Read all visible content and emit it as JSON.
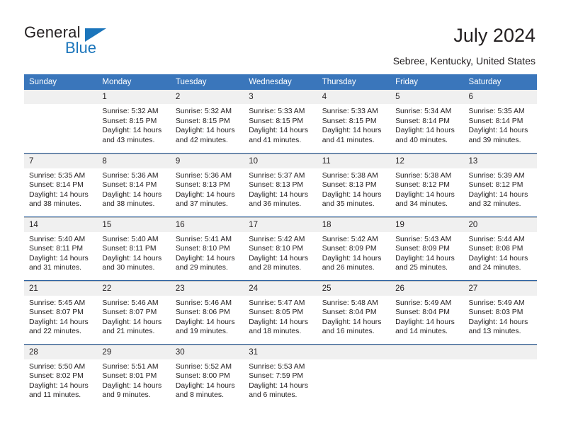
{
  "brand": {
    "name_part1": "General",
    "name_part2": "Blue",
    "color_primary": "#1b75bb",
    "color_text": "#231f20"
  },
  "header": {
    "title": "July 2024",
    "subtitle": "Sebree, Kentucky, United States",
    "accent_color": "#3a76bb",
    "band_color": "#f0f0f0"
  },
  "calendar": {
    "weekday_headers": [
      "Sunday",
      "Monday",
      "Tuesday",
      "Wednesday",
      "Thursday",
      "Friday",
      "Saturday"
    ],
    "labels": {
      "sunrise_prefix": "Sunrise:",
      "sunset_prefix": "Sunset:",
      "daylight_prefix": "Daylight:"
    },
    "weeks": [
      [
        {
          "day": "",
          "sunrise": "",
          "sunset": "",
          "daylight_line1": "",
          "daylight_line2": "",
          "empty": true
        },
        {
          "day": "1",
          "sunrise": "Sunrise: 5:32 AM",
          "sunset": "Sunset: 8:15 PM",
          "daylight_line1": "Daylight: 14 hours",
          "daylight_line2": "and 43 minutes.",
          "empty": false
        },
        {
          "day": "2",
          "sunrise": "Sunrise: 5:32 AM",
          "sunset": "Sunset: 8:15 PM",
          "daylight_line1": "Daylight: 14 hours",
          "daylight_line2": "and 42 minutes.",
          "empty": false
        },
        {
          "day": "3",
          "sunrise": "Sunrise: 5:33 AM",
          "sunset": "Sunset: 8:15 PM",
          "daylight_line1": "Daylight: 14 hours",
          "daylight_line2": "and 41 minutes.",
          "empty": false
        },
        {
          "day": "4",
          "sunrise": "Sunrise: 5:33 AM",
          "sunset": "Sunset: 8:15 PM",
          "daylight_line1": "Daylight: 14 hours",
          "daylight_line2": "and 41 minutes.",
          "empty": false
        },
        {
          "day": "5",
          "sunrise": "Sunrise: 5:34 AM",
          "sunset": "Sunset: 8:14 PM",
          "daylight_line1": "Daylight: 14 hours",
          "daylight_line2": "and 40 minutes.",
          "empty": false
        },
        {
          "day": "6",
          "sunrise": "Sunrise: 5:35 AM",
          "sunset": "Sunset: 8:14 PM",
          "daylight_line1": "Daylight: 14 hours",
          "daylight_line2": "and 39 minutes.",
          "empty": false
        }
      ],
      [
        {
          "day": "7",
          "sunrise": "Sunrise: 5:35 AM",
          "sunset": "Sunset: 8:14 PM",
          "daylight_line1": "Daylight: 14 hours",
          "daylight_line2": "and 38 minutes.",
          "empty": false
        },
        {
          "day": "8",
          "sunrise": "Sunrise: 5:36 AM",
          "sunset": "Sunset: 8:14 PM",
          "daylight_line1": "Daylight: 14 hours",
          "daylight_line2": "and 38 minutes.",
          "empty": false
        },
        {
          "day": "9",
          "sunrise": "Sunrise: 5:36 AM",
          "sunset": "Sunset: 8:13 PM",
          "daylight_line1": "Daylight: 14 hours",
          "daylight_line2": "and 37 minutes.",
          "empty": false
        },
        {
          "day": "10",
          "sunrise": "Sunrise: 5:37 AM",
          "sunset": "Sunset: 8:13 PM",
          "daylight_line1": "Daylight: 14 hours",
          "daylight_line2": "and 36 minutes.",
          "empty": false
        },
        {
          "day": "11",
          "sunrise": "Sunrise: 5:38 AM",
          "sunset": "Sunset: 8:13 PM",
          "daylight_line1": "Daylight: 14 hours",
          "daylight_line2": "and 35 minutes.",
          "empty": false
        },
        {
          "day": "12",
          "sunrise": "Sunrise: 5:38 AM",
          "sunset": "Sunset: 8:12 PM",
          "daylight_line1": "Daylight: 14 hours",
          "daylight_line2": "and 34 minutes.",
          "empty": false
        },
        {
          "day": "13",
          "sunrise": "Sunrise: 5:39 AM",
          "sunset": "Sunset: 8:12 PM",
          "daylight_line1": "Daylight: 14 hours",
          "daylight_line2": "and 32 minutes.",
          "empty": false
        }
      ],
      [
        {
          "day": "14",
          "sunrise": "Sunrise: 5:40 AM",
          "sunset": "Sunset: 8:11 PM",
          "daylight_line1": "Daylight: 14 hours",
          "daylight_line2": "and 31 minutes.",
          "empty": false
        },
        {
          "day": "15",
          "sunrise": "Sunrise: 5:40 AM",
          "sunset": "Sunset: 8:11 PM",
          "daylight_line1": "Daylight: 14 hours",
          "daylight_line2": "and 30 minutes.",
          "empty": false
        },
        {
          "day": "16",
          "sunrise": "Sunrise: 5:41 AM",
          "sunset": "Sunset: 8:10 PM",
          "daylight_line1": "Daylight: 14 hours",
          "daylight_line2": "and 29 minutes.",
          "empty": false
        },
        {
          "day": "17",
          "sunrise": "Sunrise: 5:42 AM",
          "sunset": "Sunset: 8:10 PM",
          "daylight_line1": "Daylight: 14 hours",
          "daylight_line2": "and 28 minutes.",
          "empty": false
        },
        {
          "day": "18",
          "sunrise": "Sunrise: 5:42 AM",
          "sunset": "Sunset: 8:09 PM",
          "daylight_line1": "Daylight: 14 hours",
          "daylight_line2": "and 26 minutes.",
          "empty": false
        },
        {
          "day": "19",
          "sunrise": "Sunrise: 5:43 AM",
          "sunset": "Sunset: 8:09 PM",
          "daylight_line1": "Daylight: 14 hours",
          "daylight_line2": "and 25 minutes.",
          "empty": false
        },
        {
          "day": "20",
          "sunrise": "Sunrise: 5:44 AM",
          "sunset": "Sunset: 8:08 PM",
          "daylight_line1": "Daylight: 14 hours",
          "daylight_line2": "and 24 minutes.",
          "empty": false
        }
      ],
      [
        {
          "day": "21",
          "sunrise": "Sunrise: 5:45 AM",
          "sunset": "Sunset: 8:07 PM",
          "daylight_line1": "Daylight: 14 hours",
          "daylight_line2": "and 22 minutes.",
          "empty": false
        },
        {
          "day": "22",
          "sunrise": "Sunrise: 5:46 AM",
          "sunset": "Sunset: 8:07 PM",
          "daylight_line1": "Daylight: 14 hours",
          "daylight_line2": "and 21 minutes.",
          "empty": false
        },
        {
          "day": "23",
          "sunrise": "Sunrise: 5:46 AM",
          "sunset": "Sunset: 8:06 PM",
          "daylight_line1": "Daylight: 14 hours",
          "daylight_line2": "and 19 minutes.",
          "empty": false
        },
        {
          "day": "24",
          "sunrise": "Sunrise: 5:47 AM",
          "sunset": "Sunset: 8:05 PM",
          "daylight_line1": "Daylight: 14 hours",
          "daylight_line2": "and 18 minutes.",
          "empty": false
        },
        {
          "day": "25",
          "sunrise": "Sunrise: 5:48 AM",
          "sunset": "Sunset: 8:04 PM",
          "daylight_line1": "Daylight: 14 hours",
          "daylight_line2": "and 16 minutes.",
          "empty": false
        },
        {
          "day": "26",
          "sunrise": "Sunrise: 5:49 AM",
          "sunset": "Sunset: 8:04 PM",
          "daylight_line1": "Daylight: 14 hours",
          "daylight_line2": "and 14 minutes.",
          "empty": false
        },
        {
          "day": "27",
          "sunrise": "Sunrise: 5:49 AM",
          "sunset": "Sunset: 8:03 PM",
          "daylight_line1": "Daylight: 14 hours",
          "daylight_line2": "and 13 minutes.",
          "empty": false
        }
      ],
      [
        {
          "day": "28",
          "sunrise": "Sunrise: 5:50 AM",
          "sunset": "Sunset: 8:02 PM",
          "daylight_line1": "Daylight: 14 hours",
          "daylight_line2": "and 11 minutes.",
          "empty": false
        },
        {
          "day": "29",
          "sunrise": "Sunrise: 5:51 AM",
          "sunset": "Sunset: 8:01 PM",
          "daylight_line1": "Daylight: 14 hours",
          "daylight_line2": "and 9 minutes.",
          "empty": false
        },
        {
          "day": "30",
          "sunrise": "Sunrise: 5:52 AM",
          "sunset": "Sunset: 8:00 PM",
          "daylight_line1": "Daylight: 14 hours",
          "daylight_line2": "and 8 minutes.",
          "empty": false
        },
        {
          "day": "31",
          "sunrise": "Sunrise: 5:53 AM",
          "sunset": "Sunset: 7:59 PM",
          "daylight_line1": "Daylight: 14 hours",
          "daylight_line2": "and 6 minutes.",
          "empty": false
        },
        {
          "day": "",
          "sunrise": "",
          "sunset": "",
          "daylight_line1": "",
          "daylight_line2": "",
          "empty": true
        },
        {
          "day": "",
          "sunrise": "",
          "sunset": "",
          "daylight_line1": "",
          "daylight_line2": "",
          "empty": true
        },
        {
          "day": "",
          "sunrise": "",
          "sunset": "",
          "daylight_line1": "",
          "daylight_line2": "",
          "empty": true
        }
      ]
    ]
  }
}
